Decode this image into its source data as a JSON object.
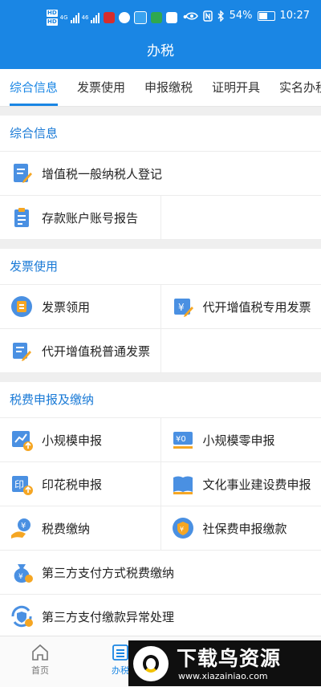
{
  "status_bar": {
    "battery": "54%",
    "time": "10:27",
    "net_hd": "HD",
    "net_4g": "4G",
    "net_46": "46"
  },
  "title": "办税",
  "tabs": [
    "综合信息",
    "发票使用",
    "申报缴税",
    "证明开具",
    "实名办税"
  ],
  "sections": [
    {
      "title": "综合信息",
      "items": [
        {
          "label": "增值税一般纳税人登记",
          "icon": "edit-document-icon"
        },
        {
          "label": "存款账户账号报告",
          "icon": "clipboard-icon"
        }
      ]
    },
    {
      "title": "发票使用",
      "items": [
        {
          "label": "发票领用",
          "icon": "invoice-receive-icon"
        },
        {
          "label": "代开增值税专用发票",
          "icon": "yen-invoice-icon"
        },
        {
          "label": "代开增值税普通发票",
          "icon": "document-edit-icon"
        }
      ]
    },
    {
      "title": "税费申报及缴纳",
      "items": [
        {
          "label": "小规模申报",
          "icon": "chart-upload-icon"
        },
        {
          "label": "小规模零申报",
          "icon": "yen-zero-icon"
        },
        {
          "label": "印花税申报",
          "icon": "stamp-tax-icon"
        },
        {
          "label": "文化事业建设费申报",
          "icon": "book-icon"
        },
        {
          "label": "税费缴纳",
          "icon": "coin-hand-icon"
        },
        {
          "label": "社保费申报缴款",
          "icon": "shield-badge-icon"
        },
        {
          "label": "第三方支付方式税费缴纳",
          "icon": "money-bag-icon"
        },
        {
          "label": "第三方支付缴款异常处理",
          "icon": "refresh-shield-icon"
        }
      ]
    }
  ],
  "bottom_nav": [
    {
      "label": "首页",
      "icon": "home-icon"
    },
    {
      "label": "办税",
      "icon": "list-icon"
    }
  ],
  "watermark": {
    "title": "下载鸟资源",
    "url": "www.xiazainiao.com"
  },
  "colors": {
    "primary": "#1a86e4",
    "section_title": "#1a7ad6",
    "icon_blue": "#4a90e2",
    "icon_yellow": "#f5a623"
  }
}
